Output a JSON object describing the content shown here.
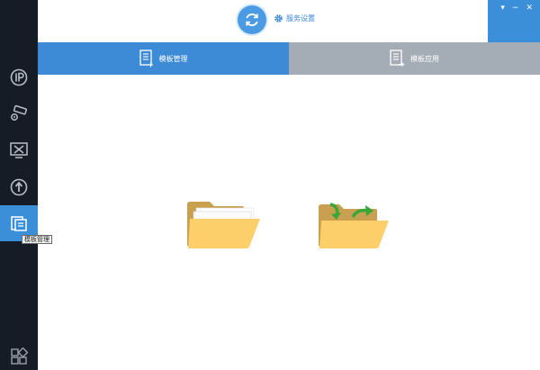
{
  "header": {
    "settings_label": "服务设置",
    "window_controls": {
      "menu": "▾",
      "minimize": "−",
      "close": "✕"
    }
  },
  "tabs": [
    {
      "label": "模板管理",
      "active": true
    },
    {
      "label": "模板应用",
      "active": false
    }
  ],
  "sidebar": {
    "items": [
      {
        "icon": "ip-icon"
      },
      {
        "icon": "camera-settings-icon"
      },
      {
        "icon": "tools-icon"
      },
      {
        "icon": "upgrade-icon"
      },
      {
        "icon": "template-icon",
        "active": true
      },
      {
        "icon": "grid-icon"
      }
    ],
    "tooltip": "模板管理"
  },
  "colors": {
    "sidebar_bg": "#161c26",
    "accent": "#3b8fd9",
    "tab_inactive": "#a4adb5",
    "folder_front": "#fccf6a",
    "folder_back": "#c9a050",
    "arrow": "#3aa63a"
  }
}
